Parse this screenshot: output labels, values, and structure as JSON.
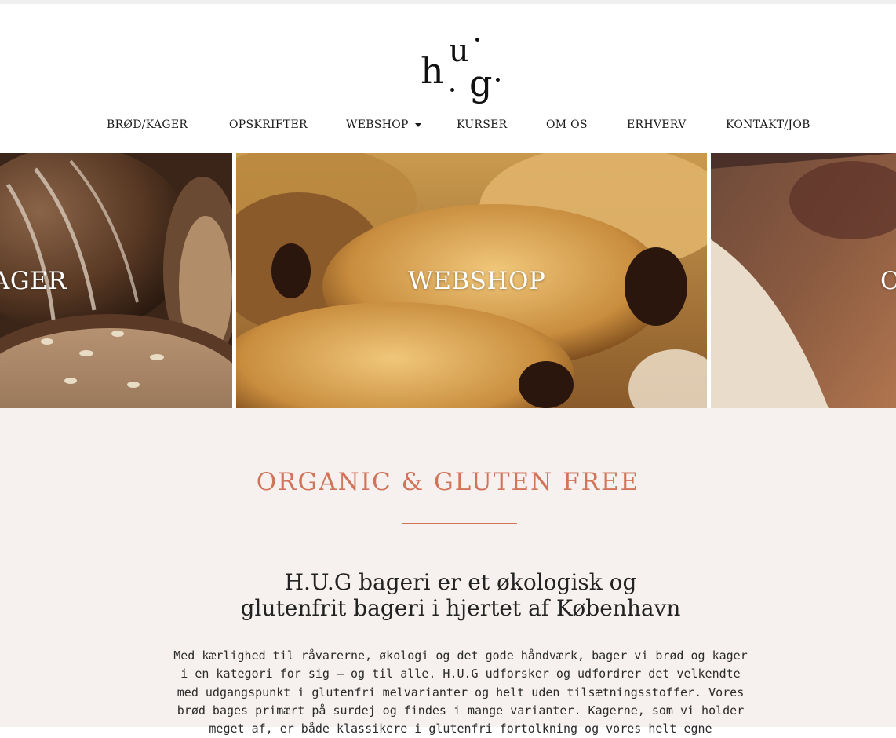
{
  "brand": {
    "logo_text": "h.u.g.",
    "logo_letters": [
      "h",
      "u",
      "g"
    ]
  },
  "nav": {
    "items": [
      {
        "label": "BRØD/KAGER"
      },
      {
        "label": "OPSKRIFTER"
      },
      {
        "label": "WEBSHOP",
        "has_dropdown": true
      },
      {
        "label": "KURSER"
      },
      {
        "label": "OM OS"
      },
      {
        "label": "ERHVERV"
      },
      {
        "label": "KONTAKT/JOB"
      }
    ]
  },
  "tiles": [
    {
      "label": "AGER"
    },
    {
      "label": "WEBSHOP"
    },
    {
      "label": "O"
    }
  ],
  "intro": {
    "kicker": "ORGANIC & GLUTEN FREE",
    "headline_line1": "H.U.G bageri er et økologisk og",
    "headline_line2": "glutenfrit bageri i hjertet af København",
    "body_lines": [
      "Med kærlighed til råvarerne, økologi og det gode håndværk, bager vi brød og kager",
      "i en kategori for sig – og til alle. H.U.G udforsker og udfordrer det velkendte",
      "med udgangspunkt i glutenfri melvarianter og helt uden tilsætningsstoffer. Vores",
      "brød bages primært på surdej og findes i mange varianter. Kagerne, som vi holder",
      "meget af, er både klassikere i glutenfri fortolkning og vores helt egne"
    ]
  },
  "colors": {
    "accent": "#d0745a",
    "section_bg": "#f6f0ee",
    "text": "#222222"
  }
}
